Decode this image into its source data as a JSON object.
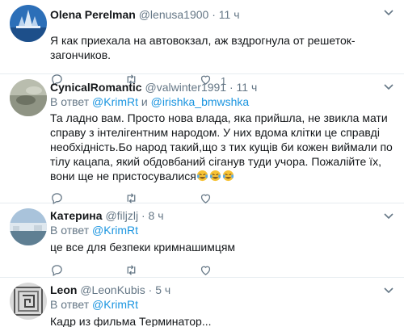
{
  "tweets": [
    {
      "name": "Olena Perelman",
      "handle": "@lenusa1900",
      "separator": "·",
      "time": "11 ч",
      "reply_prefix": "",
      "reply_to": "",
      "reply_joiner": "",
      "reply_to_2": "",
      "text": "Я как приехала на автовокзал, аж вздрогнула от решеток- загончиков.",
      "replies": "",
      "retweets": "",
      "likes": "1"
    },
    {
      "name": "CynicalRomantic",
      "handle": "@valwinter1991",
      "separator": "·",
      "time": "11 ч",
      "reply_prefix": "В ответ",
      "reply_to": "@KrimRt",
      "reply_joiner": "и",
      "reply_to_2": "@irishka_bmwshka",
      "text": "Та ладно вам. Просто нова влада, яка прийшла, не звикла мати справу з інтелігентним народом. У них вдома клітки це справді необхідність.Бо народ такий,що з тих кущів би кожен виймали по тілу кацапа, який обдовбаний сіганув туди учора. Пожалійте їх, вони ще не пристосувалися",
      "emoji": [
        "tears-of-joy",
        "tears-of-joy",
        "tears-of-joy"
      ],
      "replies": "",
      "retweets": "",
      "likes": ""
    },
    {
      "name": "Катерина",
      "handle": "@filjzlj",
      "separator": "·",
      "time": "8 ч",
      "reply_prefix": "В ответ",
      "reply_to": "@KrimRt",
      "text": "це все для безпеки кримнашимцям",
      "replies": "",
      "retweets": "",
      "likes": ""
    },
    {
      "name": "Leon",
      "handle": "@LeonKubis",
      "separator": "·",
      "time": "5 ч",
      "reply_prefix": "В ответ",
      "reply_to": "@KrimRt",
      "text": "Кадр из фильма Терминатор..."
    }
  ],
  "icons": {
    "caret": "chevron-down-icon",
    "reply": "reply-icon",
    "retweet": "retweet-icon",
    "like": "heart-icon"
  },
  "colors": {
    "link": "#1b95e0",
    "muted": "#657786",
    "text": "#14171a",
    "divider": "#e6ecf0"
  }
}
